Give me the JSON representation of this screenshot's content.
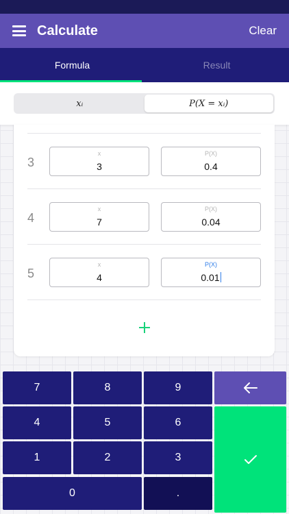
{
  "app": {
    "title": "Calculate",
    "clear_label": "Clear"
  },
  "tabs": [
    {
      "label": "Formula"
    },
    {
      "label": "Result"
    }
  ],
  "segment": {
    "left": "xᵢ",
    "right": "P(X = xᵢ)"
  },
  "rows": [
    {
      "num": "3",
      "x_label": "x",
      "x_value": "3",
      "p_label": "P(X)",
      "p_value": "0.4"
    },
    {
      "num": "4",
      "x_label": "x",
      "x_value": "7",
      "p_label": "P(X)",
      "p_value": "0.04"
    },
    {
      "num": "5",
      "x_label": "x",
      "x_value": "4",
      "p_label": "P(X)",
      "p_value": "0.01"
    }
  ],
  "keypad": {
    "k7": "7",
    "k8": "8",
    "k9": "9",
    "k4": "4",
    "k5": "5",
    "k6": "6",
    "k1": "1",
    "k2": "2",
    "k3": "3",
    "k0": "0",
    "dot": "."
  },
  "colors": {
    "primary": "#5e4fb3",
    "dark": "#1f1d78",
    "accent": "#00e37a",
    "focus": "#2f7de8"
  },
  "icons": {
    "menu": "hamburger-icon",
    "back": "arrow-left-icon",
    "enter": "check-icon",
    "add": "plus-icon"
  }
}
